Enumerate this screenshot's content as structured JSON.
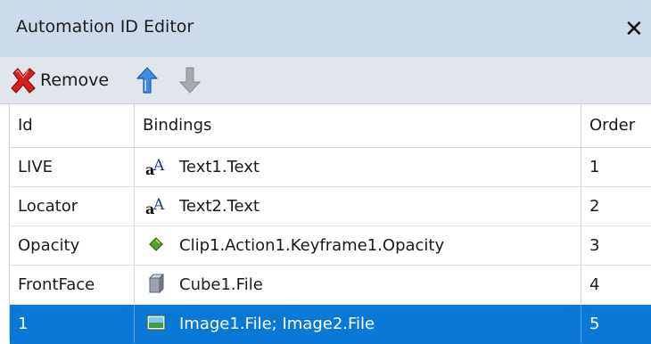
{
  "window": {
    "title": "Automation ID Editor",
    "close_glyph": "✕"
  },
  "toolbar": {
    "remove_label": "Remove",
    "remove_icon": "red-x-icon",
    "move_up_icon": "arrow-up-icon",
    "move_down_icon": "arrow-down-icon"
  },
  "table": {
    "columns": [
      "Id",
      "Bindings",
      "Order"
    ],
    "rows": [
      {
        "id": "LIVE",
        "binding": "Text1.Text",
        "order": "1",
        "icon": "text-icon"
      },
      {
        "id": "Locator",
        "binding": "Text2.Text",
        "order": "2",
        "icon": "text-icon"
      },
      {
        "id": "Opacity",
        "binding": "Clip1.Action1.Keyframe1.Opacity",
        "order": "3",
        "icon": "keyframe-diamond-icon"
      },
      {
        "id": "FrontFace",
        "binding": "Cube1.File",
        "order": "4",
        "icon": "cube-icon"
      },
      {
        "id": "1",
        "binding": "Image1.File; Image2.File",
        "order": "5",
        "icon": "image-icon",
        "selected": true
      }
    ]
  },
  "colors": {
    "titlebar": "#ccdaea",
    "toolbar": "#e1e6ec",
    "selection": "#0a78d7"
  }
}
